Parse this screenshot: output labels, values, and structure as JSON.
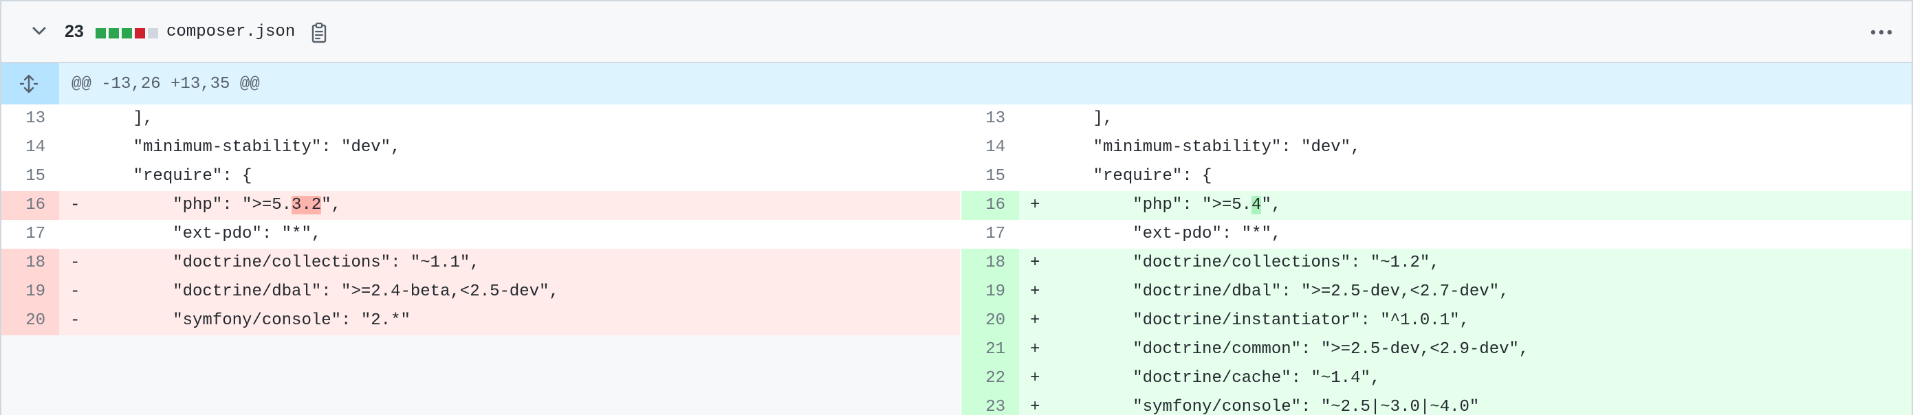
{
  "file": {
    "changes_count": "23",
    "name": "composer.json",
    "diffstat_colors": [
      "#2da44e",
      "#2da44e",
      "#2da44e",
      "#cf222e",
      "#d0d7de"
    ],
    "icons": {
      "collapse": "chevron-down-icon",
      "copy": "copy-path-icon",
      "menu": "kebab-horizontal-icon",
      "expand": "unfold-icon"
    }
  },
  "hunk": {
    "header": "@@ -13,26 +13,35 @@"
  },
  "left": {
    "rows": [
      {
        "num": "13",
        "marker": "",
        "code": "    ],",
        "type": "ctx"
      },
      {
        "num": "14",
        "marker": "",
        "code": "    \"minimum-stability\": \"dev\",",
        "type": "ctx"
      },
      {
        "num": "15",
        "marker": "",
        "code": "    \"require\": {",
        "type": "ctx"
      },
      {
        "num": "16",
        "marker": "-",
        "code_pre": "        \"php\": \">=5.",
        "code_hl": "3.2",
        "code_post": "\",",
        "type": "del"
      },
      {
        "num": "17",
        "marker": "",
        "code": "        \"ext-pdo\": \"*\",",
        "type": "ctx"
      },
      {
        "num": "18",
        "marker": "-",
        "code": "        \"doctrine/collections\": \"~1.1\",",
        "type": "del"
      },
      {
        "num": "19",
        "marker": "-",
        "code": "        \"doctrine/dbal\": \">=2.4-beta,<2.5-dev\",",
        "type": "del"
      },
      {
        "num": "20",
        "marker": "-",
        "code": "        \"symfony/console\": \"2.*\"",
        "type": "del"
      }
    ]
  },
  "right": {
    "rows": [
      {
        "num": "13",
        "marker": "",
        "code": "    ],",
        "type": "ctx"
      },
      {
        "num": "14",
        "marker": "",
        "code": "    \"minimum-stability\": \"dev\",",
        "type": "ctx"
      },
      {
        "num": "15",
        "marker": "",
        "code": "    \"require\": {",
        "type": "ctx"
      },
      {
        "num": "16",
        "marker": "+",
        "code_pre": "        \"php\": \">=5.",
        "code_hl": "4",
        "code_post": "\",",
        "type": "add"
      },
      {
        "num": "17",
        "marker": "",
        "code": "        \"ext-pdo\": \"*\",",
        "type": "ctx"
      },
      {
        "num": "18",
        "marker": "+",
        "code": "        \"doctrine/collections\": \"~1.2\",",
        "type": "add"
      },
      {
        "num": "19",
        "marker": "+",
        "code": "        \"doctrine/dbal\": \">=2.5-dev,<2.7-dev\",",
        "type": "add"
      },
      {
        "num": "20",
        "marker": "+",
        "code": "        \"doctrine/instantiator\": \"^1.0.1\",",
        "type": "add"
      },
      {
        "num": "21",
        "marker": "+",
        "code": "        \"doctrine/common\": \">=2.5-dev,<2.9-dev\",",
        "type": "add"
      },
      {
        "num": "22",
        "marker": "+",
        "code": "        \"doctrine/cache\": \"~1.4\",",
        "type": "add"
      },
      {
        "num": "23",
        "marker": "+",
        "code": "        \"symfony/console\": \"~2.5|~3.0|~4.0\"",
        "type": "add"
      }
    ]
  }
}
